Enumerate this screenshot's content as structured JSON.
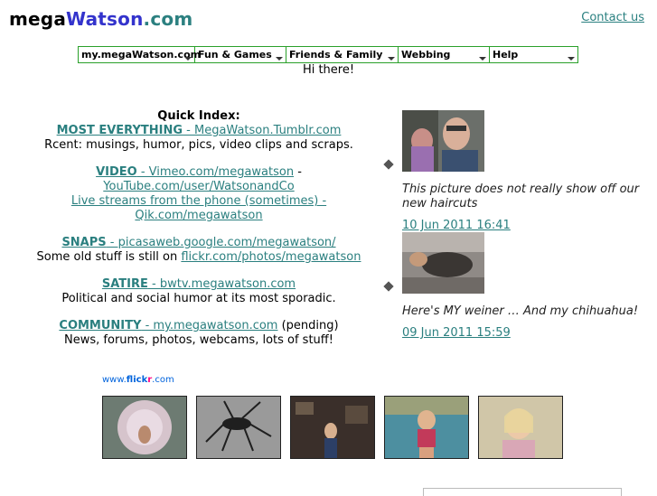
{
  "header": {
    "logo_part1": "mega",
    "logo_part2": "Watson",
    "logo_part3": ".com",
    "contact_label": "Contact us"
  },
  "menu": {
    "items": [
      {
        "label": "my.megaWatson.com"
      },
      {
        "label": "Fun & Games"
      },
      {
        "label": "Friends & Family"
      },
      {
        "label": "Webbing"
      },
      {
        "label": "Help"
      }
    ]
  },
  "greeting": "Hi there!",
  "quick_index": {
    "title": "Quick Index:",
    "most_everything": {
      "label": "MOST EVERYTHING",
      "link": " - MegaWatson.Tumblr.com",
      "desc": "Rcent: musings, humor, pics, video clips and scraps."
    },
    "video": {
      "label": "VIDEO",
      "link1": " - Vimeo.com/megawatson",
      "sep": " -",
      "link2": "YouTube.com/user/WatsonandCo",
      "link3": "Live streams from the phone (sometimes) - Qik.com/megawatson"
    },
    "snaps": {
      "label": "SNAPS",
      "link": " - picasaweb.google.com/megawatson/",
      "desc_prefix": "Some old stuff is still on ",
      "desc_link": "flickr.com/photos/megawatson"
    },
    "satire": {
      "label": "SATIRE",
      "link": " - bwtv.megawatson.com",
      "desc": "Political and social humor at its most sporadic."
    },
    "community": {
      "label": "COMMUNITY",
      "link": " - my.megawatson.com",
      "pending": " (pending)",
      "desc": "News, forums, photos, webcams, lots of stuff!"
    }
  },
  "posts": [
    {
      "caption": "This picture does not really show off our new haircuts",
      "date": "10 Jun 2011 16:41"
    },
    {
      "caption": "Here's MY weiner … And my chihuahua!",
      "date": "09 Jun 2011 15:59"
    }
  ],
  "flickr": {
    "www": "www.",
    "flick": "flick",
    "r": "r",
    "com": ".com"
  },
  "colors": {
    "link": "#2a7f7f",
    "logo_blue": "#3333cc",
    "logo_teal": "#2c8080",
    "menu_border": "#2aa02a"
  }
}
